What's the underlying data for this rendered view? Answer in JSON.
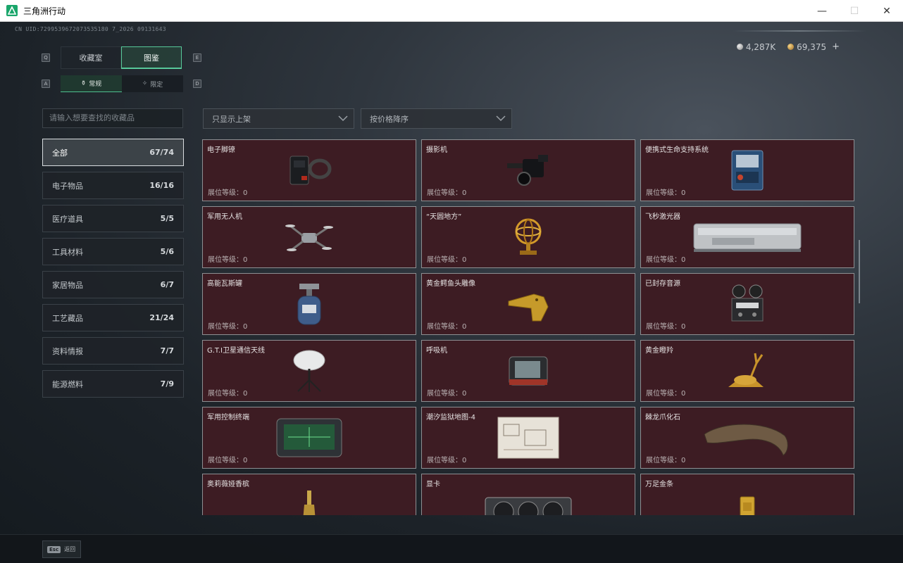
{
  "window": {
    "title": "三角洲行动",
    "min": "—",
    "max": "☐",
    "close": "✕"
  },
  "uid": "CN UID:7299539672073535180 7_2026 09131643",
  "currency": {
    "silver": "4,287K",
    "gold": "69,375",
    "plus": "+"
  },
  "keys": {
    "q": "Q",
    "e": "E",
    "a": "A",
    "d": "D"
  },
  "main_tabs": [
    {
      "label": "收藏室"
    },
    {
      "label": "图鉴"
    }
  ],
  "sub_tabs": [
    {
      "label": "常规"
    },
    {
      "label": "限定"
    }
  ],
  "search": {
    "placeholder": "请输入想要查找的收藏品"
  },
  "filters": {
    "shelf": "只显示上架",
    "sort": "按价格降序"
  },
  "categories": [
    {
      "label": "全部",
      "count": "67/74"
    },
    {
      "label": "电子物品",
      "count": "16/16"
    },
    {
      "label": "医疗道具",
      "count": "5/5"
    },
    {
      "label": "工具材料",
      "count": "5/6"
    },
    {
      "label": "家居物品",
      "count": "6/7"
    },
    {
      "label": "工艺藏品",
      "count": "21/24"
    },
    {
      "label": "资料情报",
      "count": "7/7"
    },
    {
      "label": "能源燃料",
      "count": "7/9"
    }
  ],
  "level_label": "展位等级：0",
  "items": [
    {
      "name": "电子脚镣",
      "icon": "ankle-monitor-icon"
    },
    {
      "name": "摄影机",
      "icon": "camera-icon"
    },
    {
      "name": "便携式生命支持系统",
      "icon": "life-support-icon"
    },
    {
      "name": "军用无人机",
      "icon": "drone-icon"
    },
    {
      "name": "“天圆地方”",
      "icon": "armillary-sphere-icon"
    },
    {
      "name": "飞秒激光器",
      "icon": "laser-case-icon"
    },
    {
      "name": "高能瓦斯罐",
      "icon": "gas-tank-icon"
    },
    {
      "name": "黄金鳄鱼头雕像",
      "icon": "gold-crocodile-icon"
    },
    {
      "name": "已封存音源",
      "icon": "reel-recorder-icon"
    },
    {
      "name": "G.T.I卫星通信天线",
      "icon": "satellite-dish-icon"
    },
    {
      "name": "呼吸机",
      "icon": "ventilator-icon"
    },
    {
      "name": "黄金瞪羚",
      "icon": "gold-gazelle-icon"
    },
    {
      "name": "军用控制终端",
      "icon": "control-terminal-icon"
    },
    {
      "name": "潮汐监狱地图-4",
      "icon": "map-icon"
    },
    {
      "name": "棘龙爪化石",
      "icon": "claw-fossil-icon"
    },
    {
      "name": "奥莉薇娅香槟",
      "icon": "champagne-icon"
    },
    {
      "name": "显卡",
      "icon": "graphics-card-icon"
    },
    {
      "name": "万足金条",
      "icon": "gold-bar-icon"
    }
  ],
  "bottom": {
    "esc_key": "Esc",
    "esc_label": "返回"
  },
  "colors": {
    "accent": "#57c99a",
    "card_bg": "#3d1c23",
    "card_border": "#8d8f92"
  }
}
